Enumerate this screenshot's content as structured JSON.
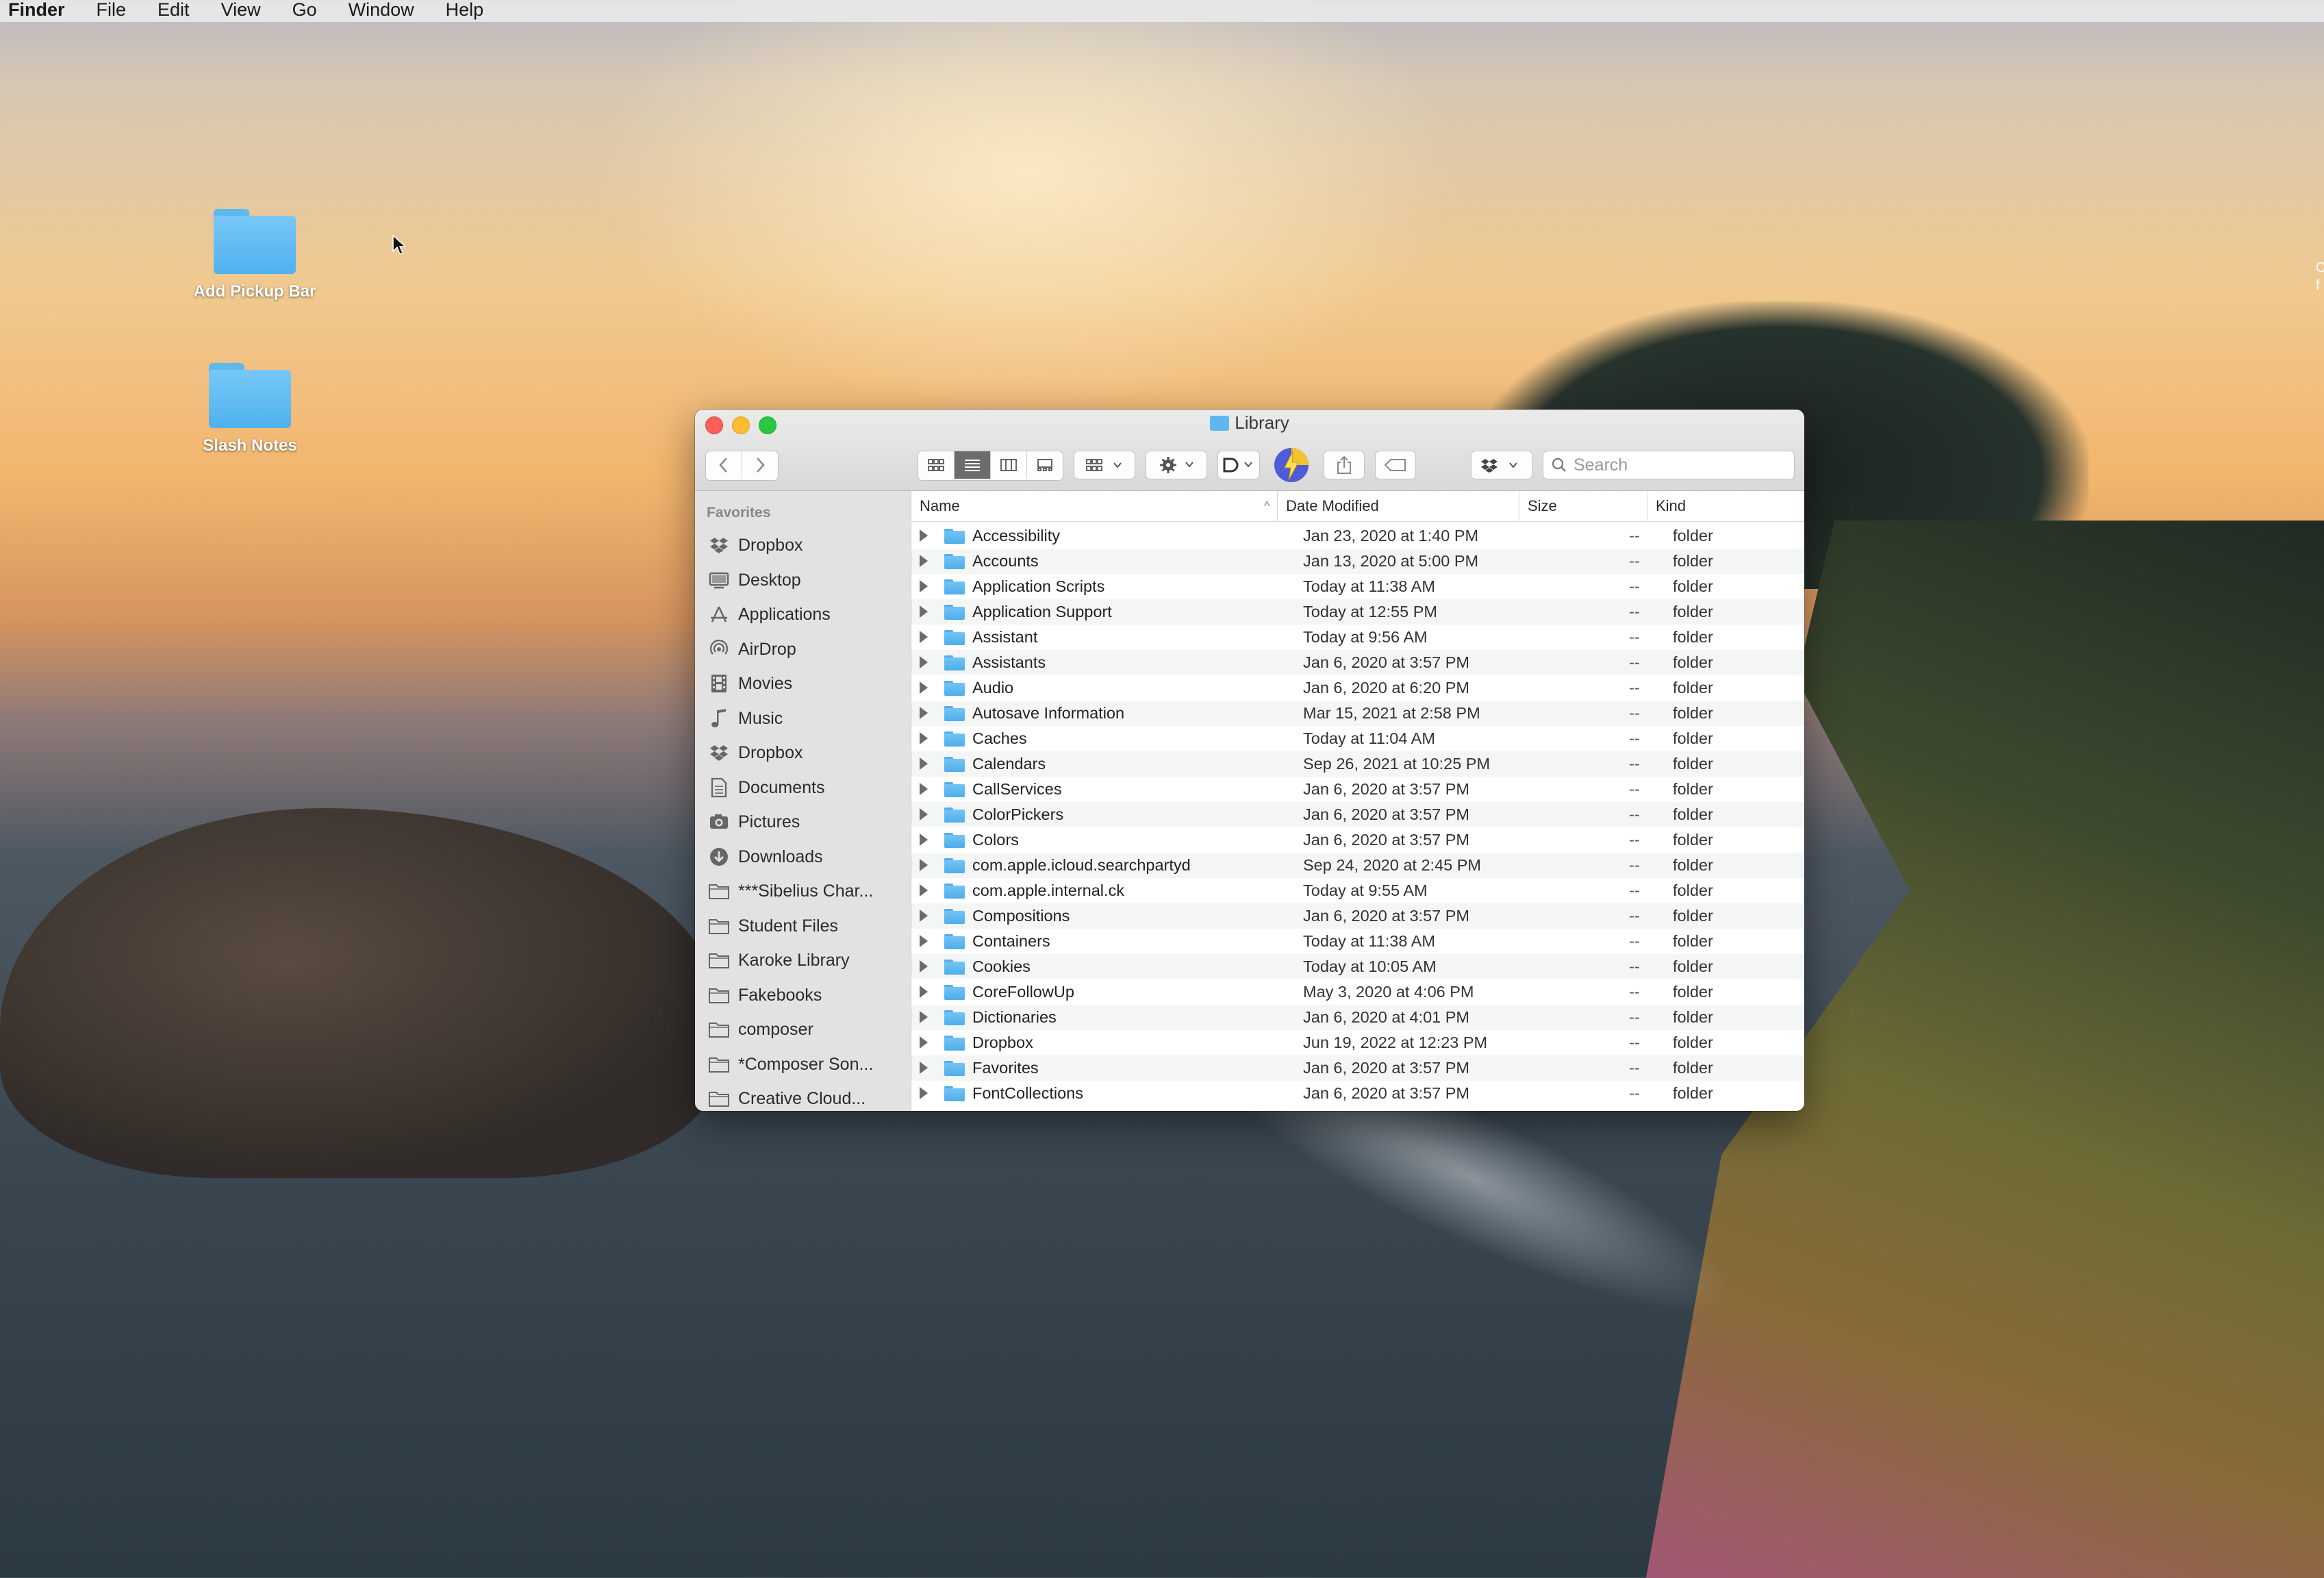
{
  "menubar": {
    "app": "Finder",
    "items": [
      "File",
      "Edit",
      "View",
      "Go",
      "Window",
      "Help"
    ]
  },
  "desktop": {
    "icons": [
      {
        "label": "Add Pickup Bar"
      },
      {
        "label": "Slash Notes"
      }
    ]
  },
  "window": {
    "title": "Library",
    "search_placeholder": "Search",
    "toolbar_icons": [
      "back-icon",
      "forward-icon",
      "icon-view-icon",
      "list-view-icon",
      "column-view-icon",
      "gallery-view-icon",
      "group-icon",
      "action-gear-icon",
      "app-extension-icon",
      "lightning-app-icon",
      "share-icon",
      "tag-icon",
      "dropbox-icon",
      "search-icon"
    ],
    "colors": {
      "accent_folder": "#4fb1ee",
      "close": "#fe5f57",
      "minimize": "#febc2e",
      "maximize": "#28c840"
    }
  },
  "sidebar": {
    "heading": "Favorites",
    "items": [
      {
        "label": "Dropbox",
        "icon": "dropbox-icon"
      },
      {
        "label": "Desktop",
        "icon": "desktop-icon"
      },
      {
        "label": "Applications",
        "icon": "applications-icon"
      },
      {
        "label": "AirDrop",
        "icon": "airdrop-icon"
      },
      {
        "label": "Movies",
        "icon": "movies-icon"
      },
      {
        "label": "Music",
        "icon": "music-icon"
      },
      {
        "label": "Dropbox",
        "icon": "dropbox-icon"
      },
      {
        "label": "Documents",
        "icon": "documents-icon"
      },
      {
        "label": "Pictures",
        "icon": "pictures-icon"
      },
      {
        "label": "Downloads",
        "icon": "downloads-icon"
      },
      {
        "label": "***Sibelius Char...",
        "icon": "folder-icon"
      },
      {
        "label": "Student Files",
        "icon": "folder-icon"
      },
      {
        "label": "Karoke Library",
        "icon": "folder-icon"
      },
      {
        "label": "Fakebooks",
        "icon": "folder-icon"
      },
      {
        "label": "composer",
        "icon": "folder-icon"
      },
      {
        "label": "*Composer Son...",
        "icon": "folder-icon"
      },
      {
        "label": "Creative Cloud...",
        "icon": "folder-icon"
      }
    ]
  },
  "list": {
    "columns": {
      "name": "Name",
      "date": "Date Modified",
      "size": "Size",
      "kind": "Kind"
    },
    "rows": [
      {
        "name": "Accessibility",
        "date": "Jan 23, 2020 at 1:40 PM",
        "size": "--",
        "kind": "folder"
      },
      {
        "name": "Accounts",
        "date": "Jan 13, 2020 at 5:00 PM",
        "size": "--",
        "kind": "folder"
      },
      {
        "name": "Application Scripts",
        "date": "Today at 11:38 AM",
        "size": "--",
        "kind": "folder"
      },
      {
        "name": "Application Support",
        "date": "Today at 12:55 PM",
        "size": "--",
        "kind": "folder"
      },
      {
        "name": "Assistant",
        "date": "Today at 9:56 AM",
        "size": "--",
        "kind": "folder"
      },
      {
        "name": "Assistants",
        "date": "Jan 6, 2020 at 3:57 PM",
        "size": "--",
        "kind": "folder"
      },
      {
        "name": "Audio",
        "date": "Jan 6, 2020 at 6:20 PM",
        "size": "--",
        "kind": "folder"
      },
      {
        "name": "Autosave Information",
        "date": "Mar 15, 2021 at 2:58 PM",
        "size": "--",
        "kind": "folder"
      },
      {
        "name": "Caches",
        "date": "Today at 11:04 AM",
        "size": "--",
        "kind": "folder"
      },
      {
        "name": "Calendars",
        "date": "Sep 26, 2021 at 10:25 PM",
        "size": "--",
        "kind": "folder"
      },
      {
        "name": "CallServices",
        "date": "Jan 6, 2020 at 3:57 PM",
        "size": "--",
        "kind": "folder"
      },
      {
        "name": "ColorPickers",
        "date": "Jan 6, 2020 at 3:57 PM",
        "size": "--",
        "kind": "folder"
      },
      {
        "name": "Colors",
        "date": "Jan 6, 2020 at 3:57 PM",
        "size": "--",
        "kind": "folder"
      },
      {
        "name": "com.apple.icloud.searchpartyd",
        "date": "Sep 24, 2020 at 2:45 PM",
        "size": "--",
        "kind": "folder"
      },
      {
        "name": "com.apple.internal.ck",
        "date": "Today at 9:55 AM",
        "size": "--",
        "kind": "folder"
      },
      {
        "name": "Compositions",
        "date": "Jan 6, 2020 at 3:57 PM",
        "size": "--",
        "kind": "folder"
      },
      {
        "name": "Containers",
        "date": "Today at 11:38 AM",
        "size": "--",
        "kind": "folder"
      },
      {
        "name": "Cookies",
        "date": "Today at 10:05 AM",
        "size": "--",
        "kind": "folder"
      },
      {
        "name": "CoreFollowUp",
        "date": "May 3, 2020 at 4:06 PM",
        "size": "--",
        "kind": "folder"
      },
      {
        "name": "Dictionaries",
        "date": "Jan 6, 2020 at 4:01 PM",
        "size": "--",
        "kind": "folder"
      },
      {
        "name": "Dropbox",
        "date": "Jun 19, 2022 at 12:23 PM",
        "size": "--",
        "kind": "folder"
      },
      {
        "name": "Favorites",
        "date": "Jan 6, 2020 at 3:57 PM",
        "size": "--",
        "kind": "folder"
      },
      {
        "name": "FontCollections",
        "date": "Jan 6, 2020 at 3:57 PM",
        "size": "--",
        "kind": "folder"
      }
    ]
  },
  "edge_text": {
    "line1": "C",
    "line2": "f"
  }
}
